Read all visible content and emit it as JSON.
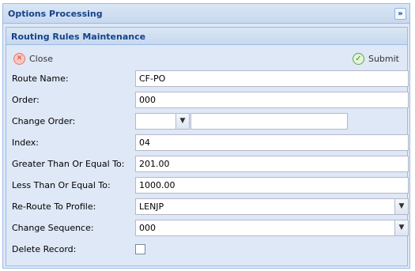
{
  "outer_panel": {
    "title": "Options Processing",
    "collapse_glyph": "»"
  },
  "inner_panel": {
    "title": "Routing Rules Maintenance"
  },
  "toolbar": {
    "close_label": "Close",
    "submit_label": "Submit"
  },
  "icons": {
    "close": "close-circle-icon",
    "submit": "check-circle-icon",
    "dropdown": "chevron-down-icon"
  },
  "form": {
    "route_name": {
      "label": "Route Name:",
      "value": "CF-PO"
    },
    "order": {
      "label": "Order:",
      "value": "000"
    },
    "change_order": {
      "label": "Change Order:",
      "select_value": "",
      "text_value": ""
    },
    "index": {
      "label": "Index:",
      "value": "04"
    },
    "greater_than": {
      "label": "Greater Than Or Equal To:",
      "value": "201.00"
    },
    "less_than": {
      "label": "Less Than Or Equal To:",
      "value": "1000.00"
    },
    "reroute_profile": {
      "label": "Re-Route To Profile:",
      "value": "LENJP"
    },
    "change_sequence": {
      "label": "Change Sequence:",
      "value": "000"
    },
    "delete_record": {
      "label": "Delete Record:",
      "checked": false
    }
  },
  "colors": {
    "header_text": "#15428b",
    "panel_bg": "#dfe8f6",
    "border": "#99bbe8"
  }
}
